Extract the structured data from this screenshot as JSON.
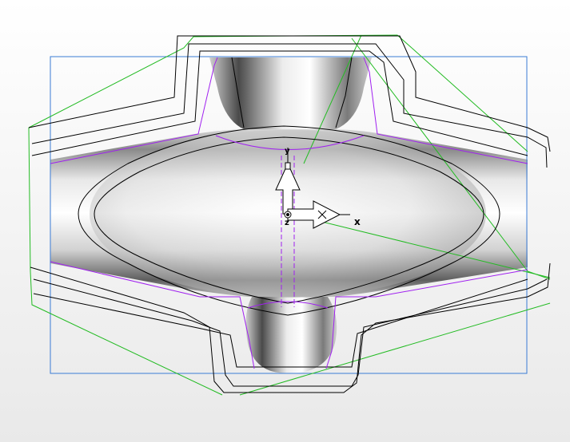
{
  "viewport": {
    "background_top": "#ffffff",
    "background_bottom": "#e9e9e9",
    "stock_box_color": "#3a7bd5",
    "toolpath_color": "#000000",
    "link_move_color": "#22bb22",
    "boundary_color": "#a020f0"
  },
  "axes": {
    "x_label": "x",
    "y_label": "y",
    "z_label": "z"
  }
}
